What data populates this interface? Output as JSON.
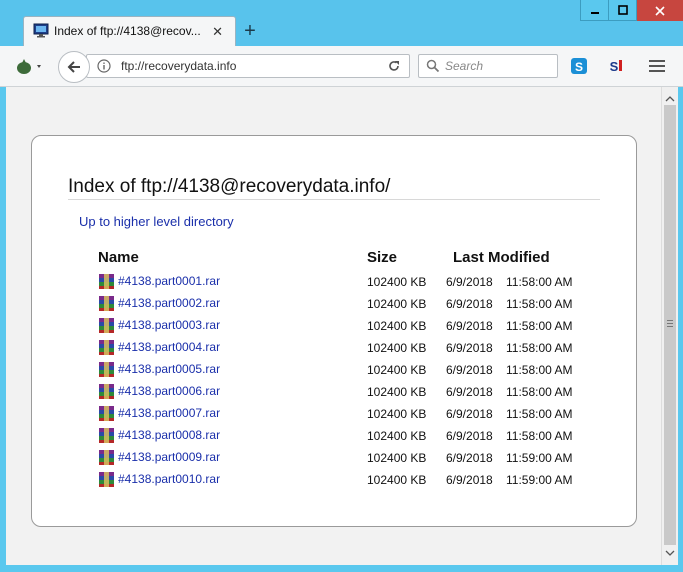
{
  "tab": {
    "title": "Index of ftp://4138@recov...",
    "close": "✕",
    "new_tab": "+"
  },
  "toolbar": {
    "url": "ftp://recoverydata.info",
    "search_placeholder": "Search"
  },
  "page": {
    "heading": "Index of ftp://4138@recoverydata.info/",
    "up_link": "Up to higher level directory",
    "columns": {
      "name": "Name",
      "size": "Size",
      "modified": "Last Modified"
    },
    "files": [
      {
        "name": "#4138.part0001.rar",
        "size": "102400 KB",
        "date": "6/9/2018",
        "time": "11:58:00 AM"
      },
      {
        "name": "#4138.part0002.rar",
        "size": "102400 KB",
        "date": "6/9/2018",
        "time": "11:58:00 AM"
      },
      {
        "name": "#4138.part0003.rar",
        "size": "102400 KB",
        "date": "6/9/2018",
        "time": "11:58:00 AM"
      },
      {
        "name": "#4138.part0004.rar",
        "size": "102400 KB",
        "date": "6/9/2018",
        "time": "11:58:00 AM"
      },
      {
        "name": "#4138.part0005.rar",
        "size": "102400 KB",
        "date": "6/9/2018",
        "time": "11:58:00 AM"
      },
      {
        "name": "#4138.part0006.rar",
        "size": "102400 KB",
        "date": "6/9/2018",
        "time": "11:58:00 AM"
      },
      {
        "name": "#4138.part0007.rar",
        "size": "102400 KB",
        "date": "6/9/2018",
        "time": "11:58:00 AM"
      },
      {
        "name": "#4138.part0008.rar",
        "size": "102400 KB",
        "date": "6/9/2018",
        "time": "11:58:00 AM"
      },
      {
        "name": "#4138.part0009.rar",
        "size": "102400 KB",
        "date": "6/9/2018",
        "time": "11:59:00 AM"
      },
      {
        "name": "#4138.part0010.rar",
        "size": "102400 KB",
        "date": "6/9/2018",
        "time": "11:59:00 AM"
      }
    ]
  },
  "colors": {
    "titlebar": "#58c3ec",
    "link": "#1a2faa",
    "close_button": "#c7463f"
  },
  "icons": [
    "monitor-icon",
    "close-icon",
    "plus-icon",
    "home-icon",
    "back-arrow-icon",
    "info-icon",
    "reload-icon",
    "search-icon",
    "skype-icon",
    "addon-icon",
    "menu-icon",
    "rar-archive-icon"
  ]
}
